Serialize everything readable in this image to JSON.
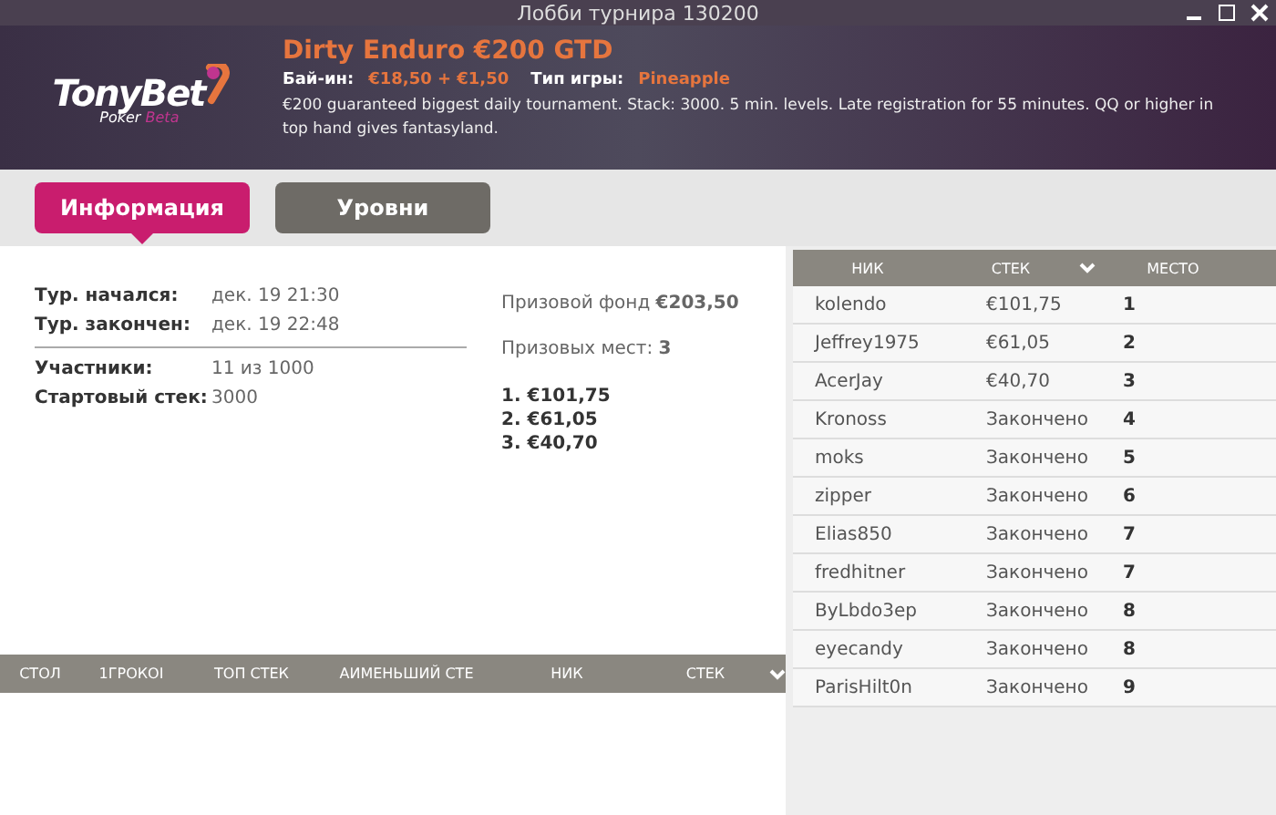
{
  "window": {
    "title": "Лобби турнира 130200"
  },
  "header": {
    "logo": "TonyBet",
    "logo_sub": "Poker",
    "logo_badge": "Beta",
    "title": "Dirty Enduro €200 GTD",
    "buyin_label": "Бай-ин:",
    "buyin": "€18,50 + €1,50",
    "game_label": "Тип игры:",
    "game": "Pineapple",
    "description": "€200 guaranteed biggest daily tournament. Stack: 3000. 5 min. levels. Late registration for 55 minutes. QQ or higher in top hand gives fantasyland."
  },
  "tabs": [
    {
      "label": "Информация",
      "selected": true
    },
    {
      "label": "Уровни",
      "selected": false
    }
  ],
  "info": {
    "times": [
      {
        "label": "Тур. начался:",
        "value": "дек. 19 21:30"
      },
      {
        "label": "Тур. закончен:",
        "value": "дек. 19 22:48"
      }
    ],
    "details": [
      {
        "label": "Участники:",
        "value": "11 из 1000"
      },
      {
        "label": "Стартовый стек:",
        "value": "3000"
      }
    ],
    "prize_pool": "Призовой фонд **€203,50**",
    "prize_places": "Призовых мест: **3**",
    "payouts": [
      "1. €101,75",
      "2. €61,05",
      "3. €40,70"
    ]
  },
  "tables_list": {
    "columns": [
      "СТОЛ",
      "1ГРОКОI",
      "ТОП СТЕК",
      "АИМЕНЬШИЙ СТЕ"
    ]
  },
  "table_players": {
    "columns": [
      "НИК",
      "СТЕК"
    ]
  },
  "players": {
    "columns": [
      "НИК",
      "СТЕК",
      "МЕСТО"
    ],
    "rows": [
      [
        "kolendo",
        "€101,75",
        "1"
      ],
      [
        "Jeffrey1975",
        "€61,05",
        "2"
      ],
      [
        "AcerJay",
        "€40,70",
        "3"
      ],
      [
        "Kronoss",
        "Закончено",
        "4"
      ],
      [
        "moks",
        "Закончено",
        "5"
      ],
      [
        "zipper",
        "Закончено",
        "6"
      ],
      [
        "Elias850",
        "Закончено",
        "7"
      ],
      [
        "fredhitner",
        "Закончено",
        "7"
      ],
      [
        "ByLbdo3ep",
        "Закончено",
        "8"
      ],
      [
        "eyecandy",
        "Закончено",
        "8"
      ],
      [
        "ParisHilt0n",
        "Закончено",
        "9"
      ]
    ]
  }
}
